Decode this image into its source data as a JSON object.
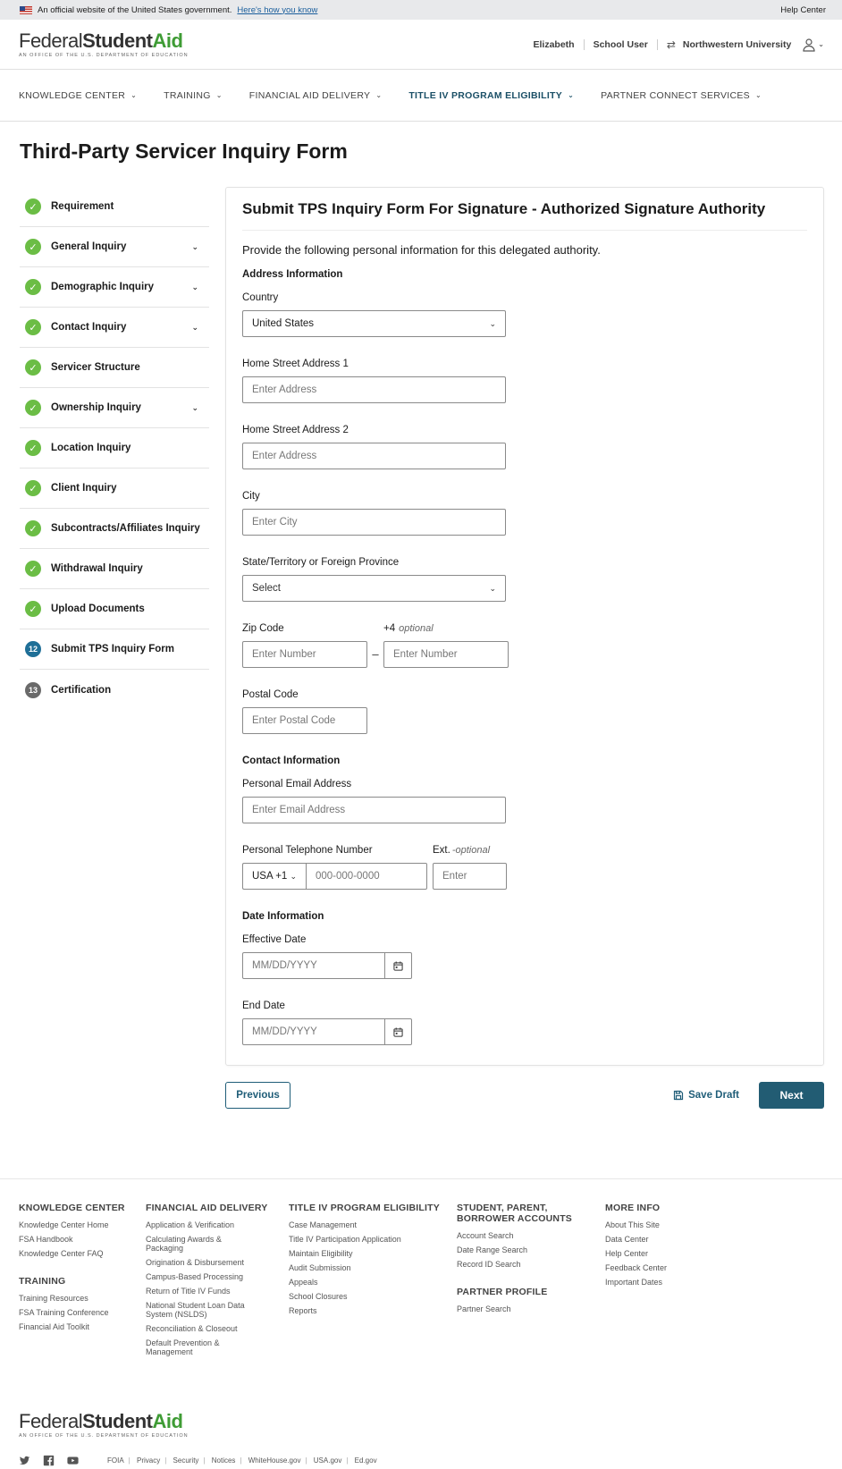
{
  "gov_banner": {
    "text": "An official website of the United States government.",
    "how": "Here's how you know",
    "help": "Help Center"
  },
  "header": {
    "logo_federal": "Federal",
    "logo_student": "Student",
    "logo_aid": "Aid",
    "logo_sub": "An OFFICE of the U.S. DEPARTMENT of EDUCATION",
    "user_name": "Elizabeth",
    "role": "School User",
    "school": "Northwestern University"
  },
  "nav": [
    {
      "label": "KNOWLEDGE CENTER"
    },
    {
      "label": "TRAINING"
    },
    {
      "label": "FINANCIAL AID DELIVERY"
    },
    {
      "label": "TITLE IV PROGRAM ELIGIBILITY"
    },
    {
      "label": "PARTNER CONNECT SERVICES"
    }
  ],
  "page_title": "Third-Party Servicer Inquiry Form",
  "steps": [
    {
      "label": "Requirement",
      "status": "done"
    },
    {
      "label": "General Inquiry",
      "status": "done"
    },
    {
      "label": "Demographic Inquiry",
      "status": "done"
    },
    {
      "label": "Contact Inquiry",
      "status": "done"
    },
    {
      "label": "Servicer Structure",
      "status": "done"
    },
    {
      "label": "Ownership Inquiry",
      "status": "done"
    },
    {
      "label": "Location Inquiry",
      "status": "done"
    },
    {
      "label": "Client Inquiry",
      "status": "done"
    },
    {
      "label": "Subcontracts/Affiliates Inquiry",
      "status": "done"
    },
    {
      "label": "Withdrawal Inquiry",
      "status": "done"
    },
    {
      "label": "Upload Documents",
      "status": "done"
    },
    {
      "label": "Submit TPS Inquiry Form",
      "status": "current",
      "number": "12"
    },
    {
      "label": "Certification",
      "status": "todo",
      "number": "13"
    }
  ],
  "form": {
    "title": "Submit TPS Inquiry Form For Signature - Authorized Signature Authority",
    "intro": "Provide the following personal information for this delegated authority.",
    "address_heading": "Address Information",
    "country_label": "Country",
    "country_value": "United States",
    "street1_label": "Home Street Address 1",
    "street1_placeholder": "Enter Address",
    "street2_label": "Home Street Address 2",
    "street2_placeholder": "Enter Address",
    "city_label": "City",
    "city_placeholder": "Enter City",
    "state_label": "State/Territory or Foreign Province",
    "state_value": "Select",
    "zip_label": "Zip Code",
    "zip_placeholder": "Enter Number",
    "zip4_label": "+4",
    "zip4_optional": "optional",
    "zip4_placeholder": "Enter Number",
    "zip_dash": "–",
    "postal_label": "Postal Code",
    "postal_placeholder": "Enter Postal Code",
    "contact_heading": "Contact Information",
    "email_label": "Personal Email Address",
    "email_placeholder": "Enter Email Address",
    "phone_label": "Personal Telephone Number",
    "phone_code": "USA +1",
    "phone_placeholder": "000-000-0000",
    "ext_label": "Ext.",
    "ext_optional": "-optional",
    "ext_placeholder": "Enter",
    "date_heading": "Date Information",
    "effective_label": "Effective Date",
    "effective_placeholder": "MM/DD/YYYY",
    "end_label": "End Date",
    "end_placeholder": "MM/DD/YYYY"
  },
  "actions": {
    "previous": "Previous",
    "save_draft": "Save Draft",
    "next": "Next"
  },
  "footer": {
    "col1": {
      "heading": "KNOWLEDGE CENTER",
      "links": [
        "Knowledge Center Home",
        "FSA Handbook",
        "Knowledge Center FAQ"
      ],
      "heading2": "TRAINING",
      "links2": [
        "Training Resources",
        "FSA Training Conference",
        "Financial Aid Toolkit"
      ]
    },
    "col2": {
      "heading": "FINANCIAL AID DELIVERY",
      "links": [
        "Application & Verification",
        "Calculating Awards & Packaging",
        "Origination & Disbursement",
        "Campus-Based Processing",
        "Return of Title IV Funds",
        "National Student Loan Data System (NSLDS)",
        "Reconciliation & Closeout",
        "Default Prevention & Management"
      ]
    },
    "col3": {
      "heading": "TITLE IV PROGRAM ELIGIBILITY",
      "links": [
        "Case Management",
        "Title IV Participation Application",
        "Maintain Eligibility",
        "Audit Submission",
        "Appeals",
        "School Closures",
        "Reports"
      ]
    },
    "col4": {
      "heading": "STUDENT, PARENT, BORROWER ACCOUNTS",
      "links": [
        "Account Search",
        "Date Range Search",
        "Record ID Search"
      ],
      "heading2": "PARTNER PROFILE",
      "links2": [
        "Partner Search"
      ]
    },
    "col5": {
      "heading": "MORE INFO",
      "links": [
        "About This Site",
        "Data Center",
        "Help Center",
        "Feedback Center",
        "Important Dates"
      ]
    },
    "bottom_links": [
      "FOIA",
      "Privacy",
      "Security",
      "Notices",
      "WhiteHouse.gov",
      "USA.gov",
      "Ed.gov"
    ]
  }
}
